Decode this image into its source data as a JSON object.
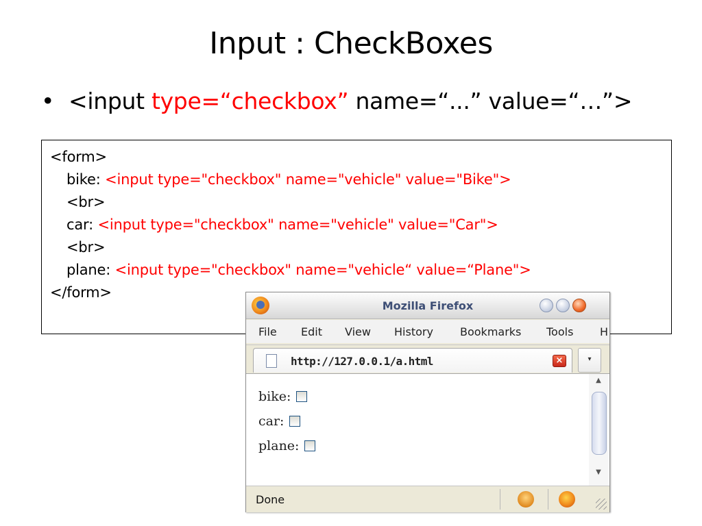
{
  "slide": {
    "title": "Input : CheckBoxes",
    "bullet": {
      "symbol": "•",
      "part1": "<input ",
      "part2": "type=“checkbox”",
      "part3": " name=“...”  value=“…”>"
    }
  },
  "code": {
    "line1": "<form>",
    "line2_label": "bike:  ",
    "line2_code": "<input type=\"checkbox\" name=\"vehicle\" value=\"Bike\">",
    "line3": "<br>",
    "line4_label": "car:   ",
    "line4_code": "<input type=\"checkbox\" name=\"vehicle\" value=\"Car\">",
    "line5": "<br>",
    "line6_label": "plane: ",
    "line6_code": "<input type=\"checkbox\" name=\"vehicle“  value=“Plane\">",
    "line7": "</form>"
  },
  "browser": {
    "window_title": "Mozilla Firefox",
    "menu": [
      "File",
      "Edit",
      "View",
      "History",
      "Bookmarks",
      "Tools",
      "H"
    ],
    "tab_url": "http://127.0.0.1/a.html",
    "tab_close": "×",
    "tab_menu": "▾",
    "form_rows": [
      {
        "label": "bike:",
        "checked": false
      },
      {
        "label": "car:",
        "checked": false
      },
      {
        "label": "plane:",
        "checked": false
      }
    ],
    "scroll_up": "▲",
    "scroll_down": "▼",
    "status": "Done",
    "colors": {
      "accent_title": "#3e4f76",
      "code_highlight": "#ff0000"
    }
  }
}
